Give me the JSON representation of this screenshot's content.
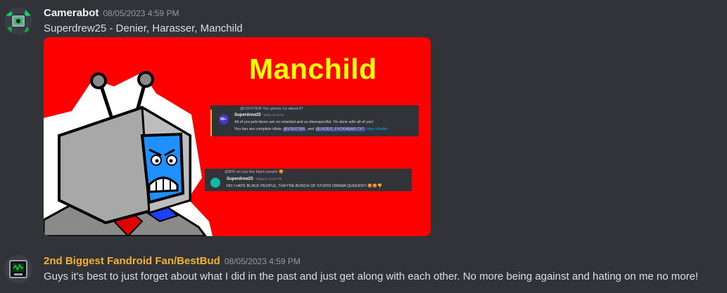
{
  "messages": [
    {
      "username": "Camerabot",
      "timestamp": "08/05/2023 4:59 PM",
      "text": "Superdrew25 - Denier, Harasser, Manchild",
      "username_color": "#f2f3f5"
    },
    {
      "username": "2nd Biggest Fandroid Fan/BestBud",
      "timestamp": "08/05/2023 4:59 PM",
      "text": "Guys it's best to just forget about what I did in the past and just get along with each other. No more being against and hating on me no more!",
      "username_color": "#f0b232"
    }
  ],
  "attachment": {
    "background": "#fe0000",
    "title": "Manchild",
    "title_color": "#ffff00",
    "embed1": {
      "reply_line": "@V3XXTER You gonna cry about it?",
      "author": "Superdrew25",
      "time": "Today at 22:24",
      "line1": "All of you jerk-faces are so retarded and so disrespectful. I'm done with all of you!",
      "line2_prefix": "You two are complete idiots",
      "mention1": "@V3XXTER",
      "line2_mid": ", and",
      "mention2": "@JXDED_FVCKHEAD.TXT",
      "link": "https://twitter",
      "avatar_label": "96+"
    },
    "embed2": {
      "reply_line": "@B00 do you like black people 😡",
      "author": "Superdrew25",
      "time": "Today at 12:22 PM",
      "line1": "NO I HATE BLACK PEOPLE, THEY'RE BUNCH OF STUPID OBAMA QUEERS!!! 😡😡👎"
    }
  }
}
